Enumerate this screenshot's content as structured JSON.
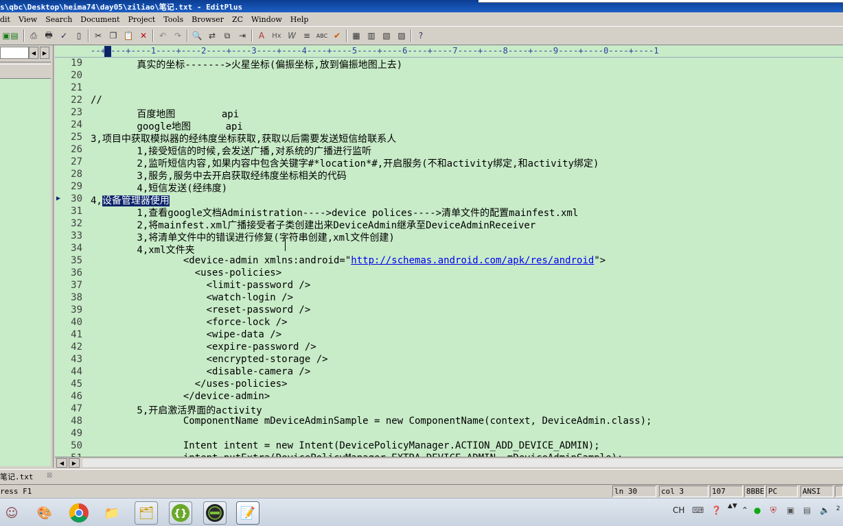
{
  "window": {
    "title": "s\\qbc\\Desktop\\heima74\\day05\\ziliao\\笔记.txt - EditPlus"
  },
  "menu": [
    "dit",
    "View",
    "Search",
    "Document",
    "Project",
    "Tools",
    "Browser",
    "ZC",
    "Window",
    "Help"
  ],
  "ruler": "--+----+----1----+----2----+----3----+----4----+----5----+----6----+----7----+----8----+----9----+----0----+----1",
  "editor": {
    "lines": [
      {
        "n": "19",
        "text": "        真实的坐标------->火星坐标(偏振坐标,放到偏振地图上去)"
      },
      {
        "n": "20",
        "text": ""
      },
      {
        "n": "21",
        "text": ""
      },
      {
        "n": "22",
        "text": "//"
      },
      {
        "n": "23",
        "text": "        百度地图        api"
      },
      {
        "n": "24",
        "text": "        google地图      api"
      },
      {
        "n": "25",
        "text": "3,项目中获取模拟器的经纬度坐标获取,获取以后需要发送短信给联系人"
      },
      {
        "n": "26",
        "text": "        1,接受短信的时候,会发送广播,对系统的广播进行监听"
      },
      {
        "n": "27",
        "text": "        2,监听短信内容,如果内容中包含关键字#*location*#,开启服务(不和activity绑定,和activity绑定)"
      },
      {
        "n": "28",
        "text": "        3,服务,服务中去开启获取经纬度坐标相关的代码"
      },
      {
        "n": "29",
        "text": "        4,短信发送(经纬度)"
      },
      {
        "n": "30",
        "prefix": "4,",
        "selected": "设备管理器使用",
        "current": true
      },
      {
        "n": "31",
        "text": "        1,查看google文档Administration---->device polices---->清单文件的配置mainfest.xml"
      },
      {
        "n": "32",
        "text": "        2,将mainfest.xml广播接受者子类创建出来DeviceAdmin继承至DeviceAdminReceiver"
      },
      {
        "n": "33",
        "text": "        3,将清单文件中的错误进行修复(字符串创建,xml文件创建)"
      },
      {
        "n": "34",
        "text": "        4,xml文件夹"
      },
      {
        "n": "35",
        "prefix": "                <device-admin xmlns:android=\"",
        "link": "http://schemas.android.com/apk/res/android",
        "suffix": "\">"
      },
      {
        "n": "36",
        "text": "                  <uses-policies>"
      },
      {
        "n": "37",
        "text": "                    <limit-password />"
      },
      {
        "n": "38",
        "text": "                    <watch-login />"
      },
      {
        "n": "39",
        "text": "                    <reset-password />"
      },
      {
        "n": "40",
        "text": "                    <force-lock />"
      },
      {
        "n": "41",
        "text": "                    <wipe-data />"
      },
      {
        "n": "42",
        "text": "                    <expire-password />"
      },
      {
        "n": "43",
        "text": "                    <encrypted-storage />"
      },
      {
        "n": "44",
        "text": "                    <disable-camera />"
      },
      {
        "n": "45",
        "text": "                  </uses-policies>"
      },
      {
        "n": "46",
        "text": "                </device-admin>"
      },
      {
        "n": "47",
        "text": "        5,开启激活界面的activity"
      },
      {
        "n": "48",
        "text": "                ComponentName mDeviceAdminSample = new ComponentName(context, DeviceAdmin.class);"
      },
      {
        "n": "49",
        "text": ""
      },
      {
        "n": "50",
        "text": "                Intent intent = new Intent(DevicePolicyManager.ACTION_ADD_DEVICE_ADMIN);"
      },
      {
        "n": "51",
        "text": "                intent.putExtra(DevicePolicyManager.EXTRA_DEVICE_ADMIN, mDeviceAdminSample);"
      }
    ]
  },
  "file_tab": {
    "name": "笔记.txt",
    "close": "⊠"
  },
  "status": {
    "help": "ress F1",
    "line": "ln 30",
    "col": "col 3",
    "count": "107",
    "code": "8BBE",
    "eol": "PC",
    "encoding": "ANSI"
  },
  "taskbar": {
    "lang": "CH",
    "apps": [
      "user-avatar",
      "paint-palette",
      "chrome",
      "folder-notes",
      "explorer",
      "braces-app",
      "android-app",
      "editplus-notebook"
    ]
  }
}
